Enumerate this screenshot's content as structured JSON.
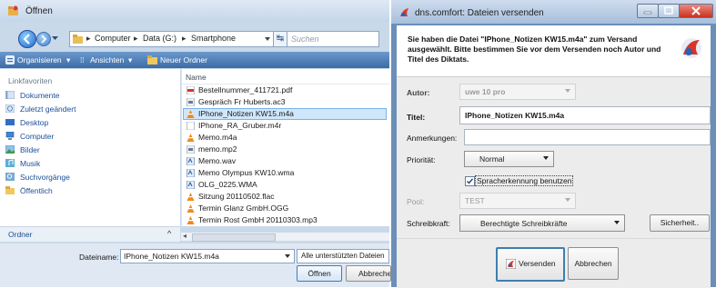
{
  "open_dialog": {
    "title": "Öffnen",
    "breadcrumb": [
      "Computer",
      "Data (G:)",
      "Smartphone"
    ],
    "search_placeholder": "Suchen",
    "toolbar": {
      "organize": "Organisieren",
      "views": "Ansichten",
      "new_folder": "Neuer Ordner"
    },
    "sidebar_header": "Linkfavoriten",
    "sidebar_items": [
      {
        "label": "Dokumente",
        "icon": "documents-icon"
      },
      {
        "label": "Zuletzt geändert",
        "icon": "recent-icon"
      },
      {
        "label": "Desktop",
        "icon": "desktop-icon"
      },
      {
        "label": "Computer",
        "icon": "computer-icon"
      },
      {
        "label": "Bilder",
        "icon": "pictures-icon"
      },
      {
        "label": "Musik",
        "icon": "music-icon"
      },
      {
        "label": "Suchvorgänge",
        "icon": "searches-icon"
      },
      {
        "label": "Öffentlich",
        "icon": "public-icon"
      }
    ],
    "folders_label": "Ordner",
    "column_name": "Name",
    "files": [
      {
        "name": "Bestellnummer_411721.pdf",
        "icon": "pdf-icon"
      },
      {
        "name": "Gespräch Fr Huberts.ac3",
        "icon": "audio-icon"
      },
      {
        "name": "IPhone_Notizen KW15.m4a",
        "icon": "vlc-icon",
        "selected": true
      },
      {
        "name": "IPhone_RA_Gruber.m4r",
        "icon": "generic-file-icon"
      },
      {
        "name": "Memo.m4a",
        "icon": "vlc-icon"
      },
      {
        "name": "memo.mp2",
        "icon": "audio-icon"
      },
      {
        "name": "Memo.wav",
        "icon": "wav-icon"
      },
      {
        "name": "Memo Olympus KW10.wma",
        "icon": "wma-icon"
      },
      {
        "name": "OLG_0225.WMA",
        "icon": "wma-icon"
      },
      {
        "name": "Sitzung 20110502.flac",
        "icon": "vlc-icon"
      },
      {
        "name": "Termin Glanz GmbH.OGG",
        "icon": "vlc-icon"
      },
      {
        "name": "Termin Rost GmbH 20110303.mp3",
        "icon": "vlc-icon"
      }
    ],
    "filename_label": "Dateiname:",
    "filename_value": "IPhone_Notizen KW15.m4a",
    "filetype_value": "Alle unterstützten Dateien",
    "open_button": "Öffnen",
    "cancel_button": "Abbreche"
  },
  "dns_dialog": {
    "title": "dns.comfort: Dateien versenden",
    "message": "Sie haben die Datei \"IPhone_Notizen KW15.m4a\" zum Versand ausgewählt. Bitte bestimmen Sie vor dem Versenden noch Autor und Titel des Diktats.",
    "author_label": "Autor:",
    "author_value": "uwe 10 pro",
    "title_label": "Titel:",
    "title_value": "IPhone_Notizen KW15.m4a",
    "remarks_label": "Anmerkungen:",
    "remarks_value": "",
    "priority_label": "Priorität:",
    "priority_value": "Normal",
    "speech_recognition_label": "Spracherkennung benutzen",
    "speech_recognition_checked": true,
    "pool_label": "Pool:",
    "pool_value": "TEST",
    "typist_label": "Schreibkraft:",
    "typist_value": "Berechtigte Schreibkräfte",
    "security_button": "Sicherheit..",
    "send_button": "Versenden",
    "cancel_button": "Abbrechen"
  },
  "colors": {
    "selection": "#cfe6fb",
    "link": "#1c4f98",
    "titlebar_close": "#d9473a"
  }
}
